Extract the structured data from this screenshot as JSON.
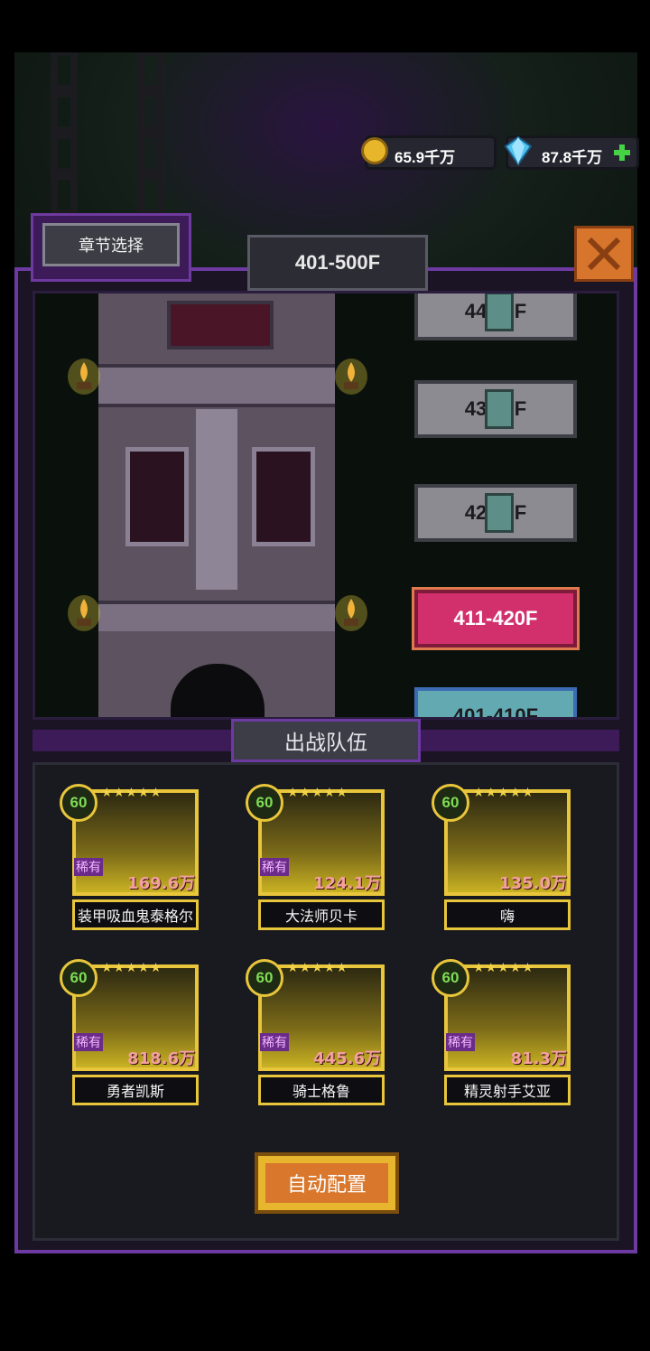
{
  "currency": {
    "gold": {
      "icon": "gold-coin-icon",
      "value": "65.9千万"
    },
    "diamond": {
      "icon": "blue-diamond-icon",
      "value": "87.8千万",
      "add_icon": "plus-icon"
    }
  },
  "header": {
    "chapter_select_label": "章节选择",
    "floor_range": "401-500F",
    "close_icon": "close-icon"
  },
  "floors": [
    {
      "label": "441-450F",
      "display": "44  50F",
      "locked": true
    },
    {
      "label": "431-440F",
      "display": "43  40F",
      "locked": true
    },
    {
      "label": "421-430F",
      "display": "42  30F",
      "locked": true
    },
    {
      "label": "411-420F",
      "display": "411-420F",
      "locked": false,
      "active": true
    },
    {
      "label": "401-410F",
      "display": "401-410F",
      "locked": false
    }
  ],
  "team": {
    "title": "出战队伍",
    "heroes": [
      {
        "level": "60",
        "rarity": "稀有",
        "power": "169.6万",
        "name": "装甲吸血鬼泰格尔"
      },
      {
        "level": "60",
        "rarity": "稀有",
        "power": "124.1万",
        "name": "大法师贝卡"
      },
      {
        "level": "60",
        "rarity": "",
        "power": "135.0万",
        "name": "嗨"
      },
      {
        "level": "60",
        "rarity": "稀有",
        "power": "818.6万",
        "name": "勇者凯斯"
      },
      {
        "level": "60",
        "rarity": "稀有",
        "power": "445.6万",
        "name": "骑士格鲁"
      },
      {
        "level": "60",
        "rarity": "稀有",
        "power": "81.3万",
        "name": "精灵射手艾亚"
      }
    ],
    "stars": "★★★★★",
    "auto_config_label": "自动配置"
  }
}
